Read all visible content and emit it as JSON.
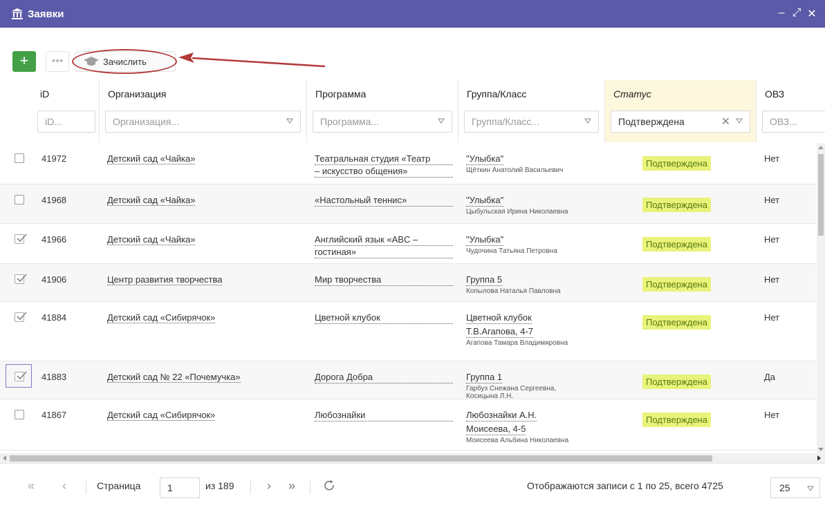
{
  "window": {
    "title": "Заявки",
    "controls": [
      "minimize-icon",
      "maximize-icon",
      "close-icon"
    ]
  },
  "toolbar": {
    "add_icon": "plus-icon",
    "more_icon": "ellipsis-icon",
    "enroll_label": "Зачислить",
    "enroll_icon": "graduation-cap-icon"
  },
  "columns": {
    "id": "iD",
    "org": "Организация",
    "program": "Программа",
    "group": "Группа/Класс",
    "status": "Статус",
    "ovz": "ОВЗ"
  },
  "filters": {
    "id_placeholder": "iD...",
    "org_placeholder": "Организация...",
    "program_placeholder": "Программа...",
    "group_placeholder": "Группа/Класс...",
    "status_value": "Подтверждена",
    "ovz_placeholder": "ОВЗ..."
  },
  "rows": [
    {
      "checked": false,
      "id": "41972",
      "org": "Детский сад «Чайка»",
      "program": [
        "Театральная студия «Театр",
        "– искусство общения»"
      ],
      "group": [
        "\"Улыбка\""
      ],
      "teacher": "Щёткин Анатолий Васильевич",
      "status": "Подтверждена",
      "ovz": "Нет"
    },
    {
      "checked": false,
      "id": "41968",
      "org": "Детский сад «Чайка»",
      "program": [
        "«Настольный теннис»"
      ],
      "group": [
        "\"Улыбка\""
      ],
      "teacher": "Цыбульская Ирина Николаевна",
      "status": "Подтверждена",
      "ovz": "Нет"
    },
    {
      "checked": true,
      "id": "41966",
      "org": "Детский сад «Чайка»",
      "program": [
        "Английский язык «ABC –",
        "гостиная»"
      ],
      "group": [
        "\"Улыбка\""
      ],
      "teacher": "Чудочина Татьяна Петровна",
      "status": "Подтверждена",
      "ovz": "Нет"
    },
    {
      "checked": true,
      "id": "41906",
      "org": "Центр развития творчества",
      "program": [
        "Мир творчества"
      ],
      "group": [
        "Группа 5"
      ],
      "teacher": "Копылова Наталья Павловна",
      "status": "Подтверждена",
      "ovz": "Нет"
    },
    {
      "checked": true,
      "id": "41884",
      "org": "Детский сад «Сибирячок»",
      "program": [
        "Цветной клубок"
      ],
      "group": [
        "Цветной клубок",
        "Т.В.Агапова, 4-7"
      ],
      "teacher": "Агапова Тамара Владимировна",
      "status": "Подтверждена",
      "ovz": "Нет"
    },
    {
      "checked": true,
      "id": "41883",
      "org": "Детский сад № 22 «Почемучка»",
      "program": [
        "Дорога Добра"
      ],
      "group": [
        "Группа 1"
      ],
      "teacher": "Гарбуз Снежана Сергеевна,\nКосицына Л.Н.",
      "status": "Подтверждена",
      "ovz": "Да"
    },
    {
      "checked": false,
      "id": "41867",
      "org": "Детский сад «Сибирячок»",
      "program": [
        "Любознайки"
      ],
      "group": [
        "Любознайки А.Н.",
        "Моисеева, 4-5"
      ],
      "teacher": "Моисеева Альбина Николаевна",
      "status": "Подтверждена",
      "ovz": "Нет"
    }
  ],
  "pager": {
    "page_label": "Страница",
    "page_value": "1",
    "of_label": "из 189",
    "summary": "Отображаются записи с 1 по 25, всего 4725",
    "page_size": "25",
    "icons": [
      "first-page-icon",
      "prev-page-icon",
      "next-page-icon",
      "last-page-icon",
      "refresh-icon"
    ]
  },
  "colors": {
    "titlebar": "#5b5aa8",
    "add_button": "#43a047",
    "status_header": "#fdf7dd",
    "badge_bg": "#e8f37a",
    "badge_text": "#5a7a10",
    "annotation": "#b23a3a"
  }
}
